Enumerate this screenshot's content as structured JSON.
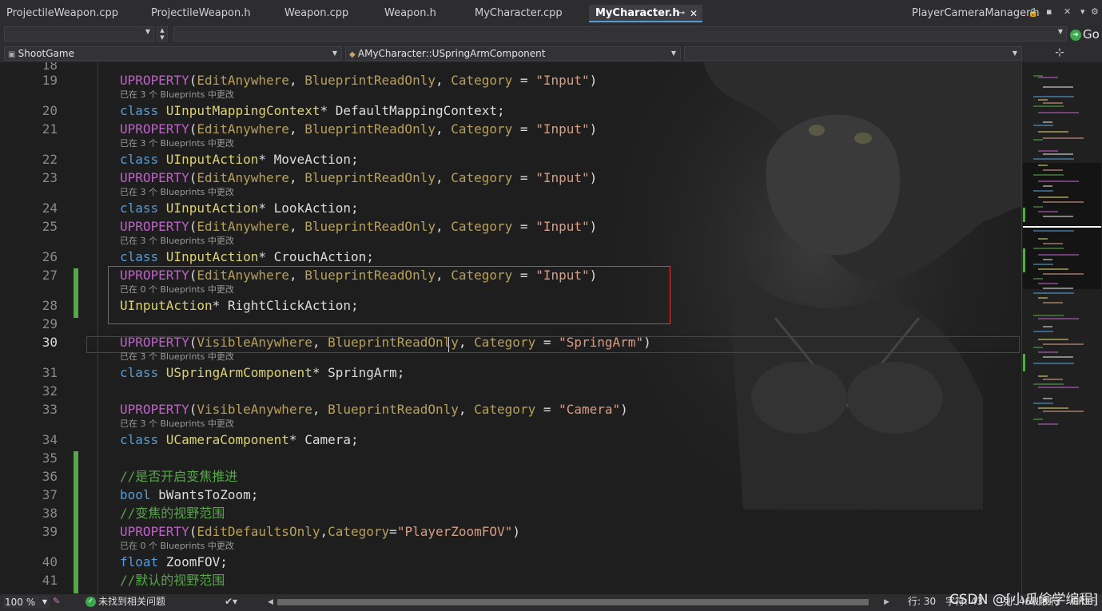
{
  "tabs": [
    {
      "label": "ProjectileWeapon.cpp"
    },
    {
      "label": "ProjectileWeapon.h"
    },
    {
      "label": "Weapon.cpp"
    },
    {
      "label": "Weapon.h"
    },
    {
      "label": "MyCharacter.cpp"
    },
    {
      "label": "MyCharacter.h",
      "active": true
    },
    {
      "label": "PlayerCameraManager.h"
    }
  ],
  "toolbar": {
    "go_label": "Go"
  },
  "nav": {
    "project": "ShootGame",
    "scope": "AMyCharacter::USpringArmComponent",
    "member": ""
  },
  "code_lines": [
    {
      "n": "18",
      "tokens": []
    },
    {
      "n": "19",
      "tokens": [
        [
          "UPROPERTY",
          "macro"
        ],
        [
          "(",
          "pun"
        ],
        [
          "EditAnywhere",
          "param"
        ],
        [
          ", ",
          "pun"
        ],
        [
          "BlueprintReadOnly",
          "param"
        ],
        [
          ", ",
          "pun"
        ],
        [
          "Category",
          "param"
        ],
        [
          " = ",
          "pun"
        ],
        [
          "\"Input\"",
          "str"
        ],
        [
          ")",
          "pun"
        ]
      ],
      "hint": "已在 3 个 Blueprints 中更改"
    },
    {
      "n": "20",
      "tokens": [
        [
          "class ",
          "kw"
        ],
        [
          "UInputMappingContext",
          "type"
        ],
        [
          "* ",
          "pun"
        ],
        [
          "DefaultMappingContext",
          "id"
        ],
        [
          ";",
          "pun"
        ]
      ]
    },
    {
      "n": "21",
      "tokens": [
        [
          "UPROPERTY",
          "macro"
        ],
        [
          "(",
          "pun"
        ],
        [
          "EditAnywhere",
          "param"
        ],
        [
          ", ",
          "pun"
        ],
        [
          "BlueprintReadOnly",
          "param"
        ],
        [
          ", ",
          "pun"
        ],
        [
          "Category",
          "param"
        ],
        [
          " = ",
          "pun"
        ],
        [
          "\"Input\"",
          "str"
        ],
        [
          ")",
          "pun"
        ]
      ],
      "hint": "已在 3 个 Blueprints 中更改"
    },
    {
      "n": "22",
      "tokens": [
        [
          "class ",
          "kw"
        ],
        [
          "UInputAction",
          "type"
        ],
        [
          "* ",
          "pun"
        ],
        [
          "MoveAction",
          "id"
        ],
        [
          ";",
          "pun"
        ]
      ]
    },
    {
      "n": "23",
      "tokens": [
        [
          "UPROPERTY",
          "macro"
        ],
        [
          "(",
          "pun"
        ],
        [
          "EditAnywhere",
          "param"
        ],
        [
          ", ",
          "pun"
        ],
        [
          "BlueprintReadOnly",
          "param"
        ],
        [
          ", ",
          "pun"
        ],
        [
          "Category",
          "param"
        ],
        [
          " = ",
          "pun"
        ],
        [
          "\"Input\"",
          "str"
        ],
        [
          ")",
          "pun"
        ]
      ],
      "hint": "已在 3 个 Blueprints 中更改"
    },
    {
      "n": "24",
      "tokens": [
        [
          "class ",
          "kw"
        ],
        [
          "UInputAction",
          "type"
        ],
        [
          "* ",
          "pun"
        ],
        [
          "LookAction",
          "id"
        ],
        [
          ";",
          "pun"
        ]
      ]
    },
    {
      "n": "25",
      "tokens": [
        [
          "UPROPERTY",
          "macro"
        ],
        [
          "(",
          "pun"
        ],
        [
          "EditAnywhere",
          "param"
        ],
        [
          ", ",
          "pun"
        ],
        [
          "BlueprintReadOnly",
          "param"
        ],
        [
          ", ",
          "pun"
        ],
        [
          "Category",
          "param"
        ],
        [
          " = ",
          "pun"
        ],
        [
          "\"Input\"",
          "str"
        ],
        [
          ")",
          "pun"
        ]
      ],
      "hint": "已在 3 个 Blueprints 中更改"
    },
    {
      "n": "26",
      "tokens": [
        [
          "class ",
          "kw"
        ],
        [
          "UInputAction",
          "type"
        ],
        [
          "* ",
          "pun"
        ],
        [
          "CrouchAction",
          "id"
        ],
        [
          ";",
          "pun"
        ]
      ]
    },
    {
      "n": "27",
      "tokens": [
        [
          "UPROPERTY",
          "macro"
        ],
        [
          "(",
          "pun"
        ],
        [
          "EditAnywhere",
          "param"
        ],
        [
          ", ",
          "pun"
        ],
        [
          "BlueprintReadOnly",
          "param"
        ],
        [
          ", ",
          "pun"
        ],
        [
          "Category",
          "param"
        ],
        [
          " = ",
          "pun"
        ],
        [
          "\"Input\"",
          "str"
        ],
        [
          ")",
          "pun"
        ]
      ],
      "hint": "已在 0 个 Blueprints 中更改"
    },
    {
      "n": "28",
      "tokens": [
        [
          "UInputAction",
          "type"
        ],
        [
          "* ",
          "pun"
        ],
        [
          "RightClickAction",
          "id"
        ],
        [
          ";",
          "pun"
        ]
      ]
    },
    {
      "n": "29",
      "tokens": []
    },
    {
      "n": "30",
      "tokens": [
        [
          "UPROPERTY",
          "macro"
        ],
        [
          "(",
          "pun"
        ],
        [
          "VisibleAnywhere",
          "param"
        ],
        [
          ", ",
          "pun"
        ],
        [
          "BlueprintReadOnly",
          "param"
        ],
        [
          ", ",
          "pun"
        ],
        [
          "Category",
          "param"
        ],
        [
          " = ",
          "pun"
        ],
        [
          "\"SpringArm\"",
          "str"
        ],
        [
          ")",
          "pun"
        ]
      ],
      "hint": "已在 3 个 Blueprints 中更改",
      "current": true
    },
    {
      "n": "31",
      "tokens": [
        [
          "class ",
          "kw"
        ],
        [
          "USpringArmComponent",
          "type"
        ],
        [
          "* ",
          "pun"
        ],
        [
          "SpringArm",
          "id"
        ],
        [
          ";",
          "pun"
        ]
      ]
    },
    {
      "n": "32",
      "tokens": []
    },
    {
      "n": "33",
      "tokens": [
        [
          "UPROPERTY",
          "macro"
        ],
        [
          "(",
          "pun"
        ],
        [
          "VisibleAnywhere",
          "param"
        ],
        [
          ", ",
          "pun"
        ],
        [
          "BlueprintReadOnly",
          "param"
        ],
        [
          ", ",
          "pun"
        ],
        [
          "Category",
          "param"
        ],
        [
          " = ",
          "pun"
        ],
        [
          "\"Camera\"",
          "str"
        ],
        [
          ")",
          "pun"
        ]
      ],
      "hint": "已在 3 个 Blueprints 中更改"
    },
    {
      "n": "34",
      "tokens": [
        [
          "class ",
          "kw"
        ],
        [
          "UCameraComponent",
          "type"
        ],
        [
          "* ",
          "pun"
        ],
        [
          "Camera",
          "id"
        ],
        [
          ";",
          "pun"
        ]
      ]
    },
    {
      "n": "35",
      "tokens": []
    },
    {
      "n": "36",
      "tokens": [
        [
          "//是否开启变焦推进",
          "cmt"
        ]
      ]
    },
    {
      "n": "37",
      "tokens": [
        [
          "bool ",
          "kw"
        ],
        [
          "bWantsToZoom",
          "id"
        ],
        [
          ";",
          "pun"
        ]
      ]
    },
    {
      "n": "38",
      "tokens": [
        [
          "//变焦的视野范围",
          "cmt"
        ]
      ]
    },
    {
      "n": "39",
      "tokens": [
        [
          "UPROPERTY",
          "macro"
        ],
        [
          "(",
          "pun"
        ],
        [
          "EditDefaultsOnly",
          "param"
        ],
        [
          ",",
          "pun"
        ],
        [
          "Category",
          "param"
        ],
        [
          "=",
          "pun"
        ],
        [
          "\"PlayerZoomFOV\"",
          "str"
        ],
        [
          ")",
          "pun"
        ]
      ],
      "hint": "已在 0 个 Blueprints 中更改"
    },
    {
      "n": "40",
      "tokens": [
        [
          "float ",
          "kw"
        ],
        [
          "ZoomFOV",
          "id"
        ],
        [
          ";",
          "pun"
        ]
      ]
    },
    {
      "n": "41",
      "tokens": [
        [
          "//默认的视野范围",
          "cmt"
        ]
      ]
    }
  ],
  "status": {
    "zoom": "100 %",
    "issues": "未找到相关问题",
    "line": "行: 30",
    "col": "字符: 43",
    "tail": "列: 46",
    "tabs": "制表符",
    "eol": "CRLF"
  },
  "watermark": "CSDN @[小瓜偷学编程]",
  "colors": {
    "background": "#1e1e1e",
    "chrome": "#2d2d30",
    "keyword": "#569cd6",
    "macro": "#bd63c5",
    "param": "#b8a05a",
    "type": "#dcd272",
    "string": "#d69d85",
    "comment": "#57a64a",
    "highlight_box": "#e03a3a",
    "change_marker": "#57a64a"
  }
}
